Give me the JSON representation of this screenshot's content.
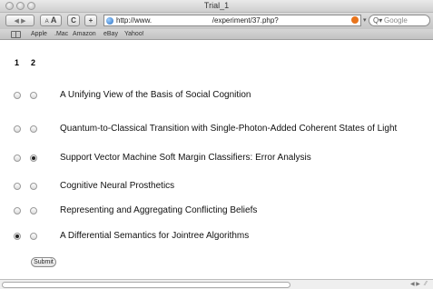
{
  "window": {
    "title": "Trial_1"
  },
  "toolbar": {
    "back_icon": "back-arrow",
    "forward_icon": "forward-arrow",
    "text_smaller": "A",
    "text_bigger": "A",
    "reload": "C",
    "add": "+",
    "url": "http://www.                              /experiment/37.php?",
    "search_placeholder": "Google"
  },
  "bookmarks": [
    "Apple",
    ".Mac",
    "Amazon",
    "eBay",
    "Yahoo!"
  ],
  "form": {
    "column_headers": [
      "1",
      "2"
    ],
    "items": [
      {
        "title": "A Unifying View of the Basis of Social Cognition",
        "selected": 0
      },
      {
        "title": "Quantum-to-Classical Transition with Single-Photon-Added Coherent States of Light",
        "selected": 0
      },
      {
        "title": "Support Vector Machine Soft Margin Classifiers: Error Analysis",
        "selected": 2
      },
      {
        "title": "Cognitive Neural Prosthetics",
        "selected": 0
      },
      {
        "title": "Representing and Aggregating Conflicting Beliefs",
        "selected": 0
      },
      {
        "title": "A Differential Semantics for Jointree Algorithms",
        "selected": 1
      }
    ],
    "submit_label": "Submit"
  },
  "colors": {
    "accent": "#2a6fc2",
    "snapback": "#e8741c"
  }
}
